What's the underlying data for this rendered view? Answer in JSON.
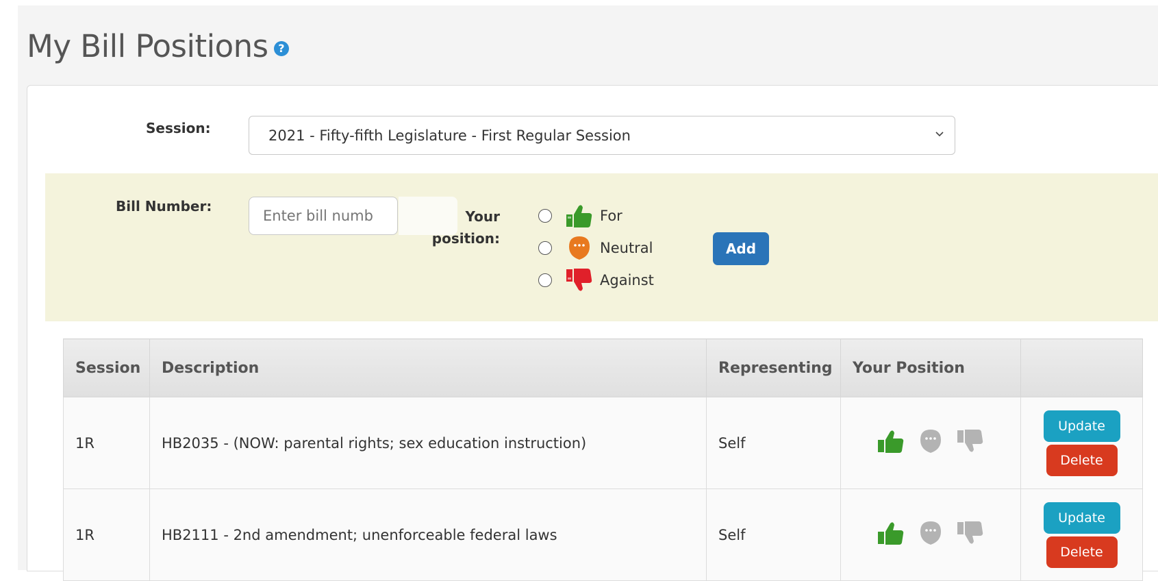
{
  "page": {
    "title": "My Bill Positions"
  },
  "session_selector": {
    "label": "Session:",
    "selected": "2021 - Fifty-fifth Legislature - First Regular Session"
  },
  "add_form": {
    "bill_label": "Bill Number:",
    "bill_placeholder": "Enter bill numb",
    "position_label_line1": "Your",
    "position_label_line2": "position:",
    "options": [
      {
        "label": "For",
        "icon": "thumbs-up-icon",
        "color": "#3a9a2a"
      },
      {
        "label": "Neutral",
        "icon": "neutral-face-icon",
        "color": "#e8791f"
      },
      {
        "label": "Against",
        "icon": "thumbs-down-icon",
        "color": "#e0202a"
      }
    ],
    "add_label": "Add"
  },
  "table": {
    "headers": [
      "Session",
      "Description",
      "Representing",
      "Your Position",
      ""
    ],
    "rows": [
      {
        "session": "1R",
        "description": "HB2035 - (NOW: parental rights; sex education instruction)",
        "representing": "Self",
        "position": "For",
        "update_label": "Update",
        "delete_label": "Delete"
      },
      {
        "session": "1R",
        "description": "HB2111 - 2nd amendment; unenforceable federal laws",
        "representing": "Self",
        "position": "For",
        "update_label": "Update",
        "delete_label": "Delete"
      }
    ]
  },
  "colors": {
    "for_active": "#3a9a2a",
    "inactive_icon": "#b3b3b3",
    "add_button": "#2a74b8",
    "update_button": "#1ba1c2",
    "delete_button": "#d83a1f",
    "form_band": "#f4f3dc"
  }
}
